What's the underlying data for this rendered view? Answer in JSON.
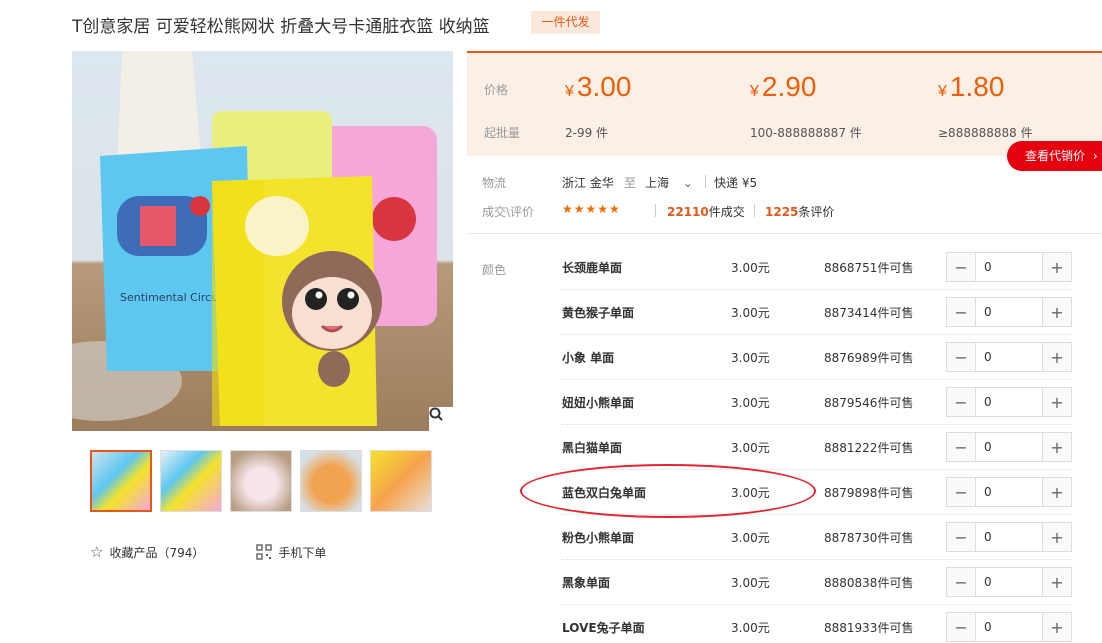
{
  "title": "T创意家居 可爱轻松熊网状 折叠大号卡通脏衣篮 收纳篮",
  "badge": "一件代发",
  "gallery": {
    "bag1_text": "Sentimental Circus.",
    "thumb_count": 5
  },
  "actions": {
    "favorite_label": "收藏产品（794）",
    "mobile_label": "手机下单"
  },
  "price": {
    "price_label": "价格",
    "moq_label": "起批量",
    "currency": "¥",
    "tiers": [
      {
        "price": "3.00",
        "range": "2-99 件"
      },
      {
        "price": "2.90",
        "range": "100-888888887 件"
      },
      {
        "price": "1.80",
        "range": "≥888888888 件"
      }
    ]
  },
  "quote_button": "查看代销价",
  "logistics": {
    "label": "物流",
    "from": "浙江 金华",
    "to_word": "至",
    "to": "上海",
    "shipping": "快递 ¥5"
  },
  "reviews": {
    "label": "成交\\评价",
    "stars": "★★★★★",
    "deals_count": "22110",
    "deals_suffix": "件成交",
    "review_count": "1225",
    "review_suffix": "条评价"
  },
  "sku": {
    "label": "颜色",
    "rows": [
      {
        "name": "长颈鹿单面",
        "price": "3.00元",
        "stock": "8868751件可售",
        "qty": "0"
      },
      {
        "name": "黄色猴子单面",
        "price": "3.00元",
        "stock": "8873414件可售",
        "qty": "0"
      },
      {
        "name": "小象 单面",
        "price": "3.00元",
        "stock": "8876989件可售",
        "qty": "0"
      },
      {
        "name": "妞妞小熊单面",
        "price": "3.00元",
        "stock": "8879546件可售",
        "qty": "0"
      },
      {
        "name": "黑白猫单面",
        "price": "3.00元",
        "stock": "8881222件可售",
        "qty": "0"
      },
      {
        "name": "蓝色双白兔单面",
        "price": "3.00元",
        "stock": "8879898件可售",
        "qty": "0"
      },
      {
        "name": "粉色小熊单面",
        "price": "3.00元",
        "stock": "8878730件可售",
        "qty": "0"
      },
      {
        "name": "黑象单面",
        "price": "3.00元",
        "stock": "8880838件可售",
        "qty": "0"
      },
      {
        "name": "LOVE兔子单面",
        "price": "3.00元",
        "stock": "8881933件可售",
        "qty": "0"
      }
    ]
  }
}
